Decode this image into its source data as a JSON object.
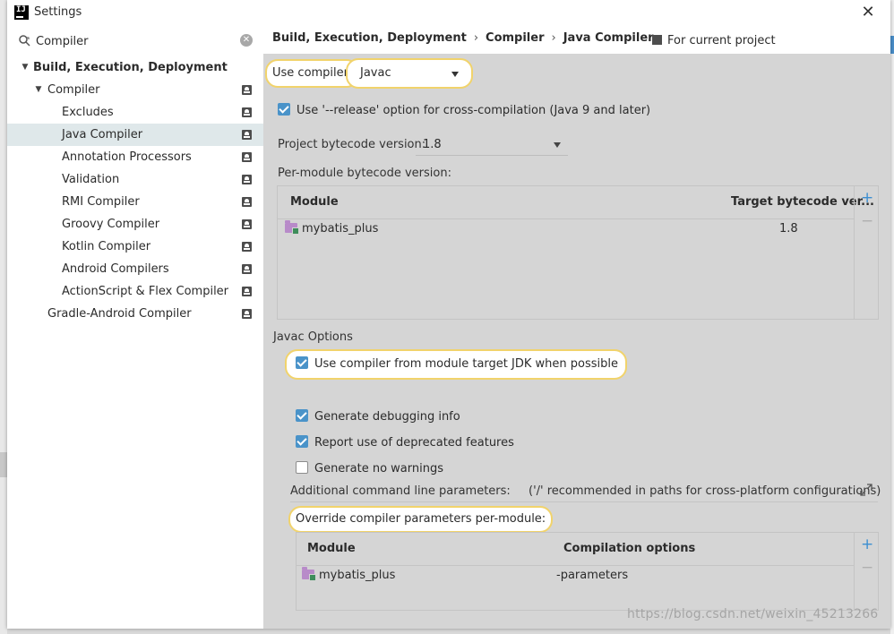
{
  "window": {
    "title": "Settings",
    "app_icon": "intellij-logo",
    "app_icon_text": "IJ",
    "close_glyph": "✕"
  },
  "search": {
    "value": "Compiler",
    "clear_glyph": "✕"
  },
  "tree": {
    "items": [
      {
        "label": "Build, Execution, Deployment",
        "expanded": true,
        "bold": true
      },
      {
        "label": "Compiler",
        "expanded": true
      },
      {
        "label": "Excludes"
      },
      {
        "label": "Java Compiler",
        "selected": true
      },
      {
        "label": "Annotation Processors"
      },
      {
        "label": "Validation"
      },
      {
        "label": "RMI Compiler"
      },
      {
        "label": "Groovy Compiler"
      },
      {
        "label": "Kotlin Compiler"
      },
      {
        "label": "Android Compilers"
      },
      {
        "label": "ActionScript & Flex Compiler"
      },
      {
        "label": "Gradle-Android Compiler"
      }
    ]
  },
  "breadcrumb": {
    "items": [
      "Build, Execution, Deployment",
      "Compiler",
      "Java Compiler"
    ],
    "separator": "›"
  },
  "scope": {
    "label": "For current project",
    "icon": "project-icon"
  },
  "compiler": {
    "use_compiler_label": "Use compiler:",
    "selected": "Javac",
    "release_option": {
      "label": "Use '--release' option for cross-compilation (Java 9 and later)",
      "checked": true
    },
    "project_bytecode_label": "Project bytecode version:",
    "project_bytecode_value": "1.8",
    "per_module_label": "Per-module bytecode version:"
  },
  "module_table": {
    "headers": [
      "Module",
      "Target bytecode ver..."
    ],
    "rows": [
      {
        "module": "mybatis_plus",
        "target": "1.8"
      }
    ],
    "add_glyph": "+",
    "remove_glyph": "−"
  },
  "javac": {
    "section_label": "Javac Options",
    "options": [
      {
        "label": "Use compiler from module target JDK when possible",
        "checked": true
      },
      {
        "label": "Generate debugging info",
        "checked": true
      },
      {
        "label": "Report use of deprecated features",
        "checked": true
      },
      {
        "label": "Generate no warnings",
        "checked": false
      }
    ],
    "additional_params_label": "Additional command line parameters:",
    "additional_params_hint": "('/' recommended in paths for cross-platform configurations)",
    "override_label": "Override compiler parameters per-module:"
  },
  "override_table": {
    "headers": [
      "Module",
      "Compilation options"
    ],
    "rows": [
      {
        "module": "mybatis_plus",
        "options": "-parameters"
      }
    ],
    "add_glyph": "+",
    "remove_glyph": "−"
  },
  "watermark": "https://blog.csdn.net/weixin_45213266",
  "colors": {
    "selection": "#dfe8ea",
    "highlight_border": "#f1d36b",
    "checkbox": "#4a93c9",
    "content_bg": "#d5d5d5"
  }
}
